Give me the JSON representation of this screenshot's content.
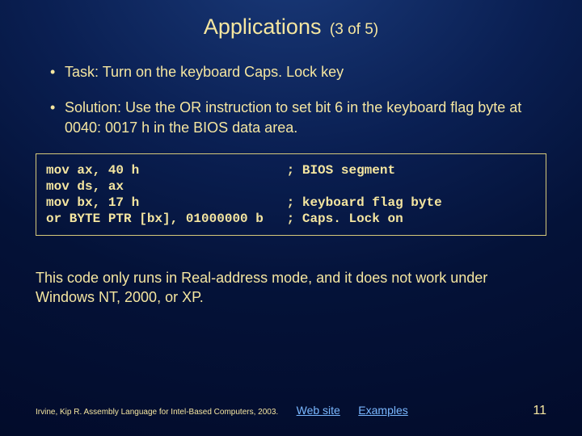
{
  "title": "Applications",
  "subtitle": "(3 of 5)",
  "bullets": [
    "Task: Turn on the keyboard Caps. Lock key",
    "Solution: Use the OR instruction to set bit 6 in the keyboard flag byte at 0040: 0017 h in the BIOS data area."
  ],
  "code": "mov ax, 40 h                   ; BIOS segment\nmov ds, ax\nmov bx, 17 h                   ; keyboard flag byte\nor BYTE PTR [bx], 01000000 b   ; Caps. Lock on",
  "note": "This code only runs in Real-address mode, and it does not work under Windows NT, 2000, or XP.",
  "footer": {
    "cite": "Irvine, Kip R. Assembly Language for Intel-Based Computers, 2003.",
    "link1": "Web site",
    "link2": "Examples",
    "page": "11"
  }
}
